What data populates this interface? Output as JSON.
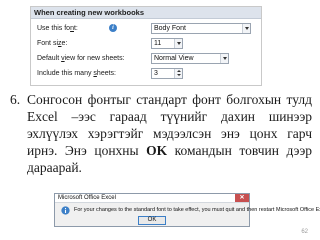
{
  "options": {
    "header": "When creating new workbooks",
    "rows": [
      {
        "label_pre": "Use this fo",
        "label_ul": "n",
        "label_post": "t:",
        "value": "Body Font",
        "control": "dropdown"
      },
      {
        "label_pre": "Font si",
        "label_ul": "z",
        "label_post": "e:",
        "value": "11",
        "control": "dropdown"
      },
      {
        "label_pre": "Default ",
        "label_ul": "v",
        "label_post": "iew for new sheets:",
        "value": "Normal View",
        "control": "dropdown"
      },
      {
        "label_pre": "Include this many ",
        "label_ul": "s",
        "label_post": "heets:",
        "value": "3",
        "control": "spinner"
      }
    ]
  },
  "step": {
    "number": "6.",
    "text_before": "Сонгосон фонтыг стандарт фонт болгохын тулд Excel –ээс гараад түүнийг дахин шинээр эхлүүлэх хэрэгтэйг мэдээлсэн энэ цонх гарч ирнэ. Энэ цонхны ",
    "text_bold": "OK",
    "text_after": " командын товчин дээр дараарай."
  },
  "dialog": {
    "title": "Microsoft Office Excel",
    "close_glyph": "✕",
    "message": "For your changes to the standard font to take effect, you must quit and then restart Microsoft Office Excel.",
    "ok_label": "OK"
  },
  "page_number": "62",
  "colors": {
    "header_bg": "#dde3ec",
    "info_icon": "#3c7fc7",
    "close_button": "#c75050"
  }
}
